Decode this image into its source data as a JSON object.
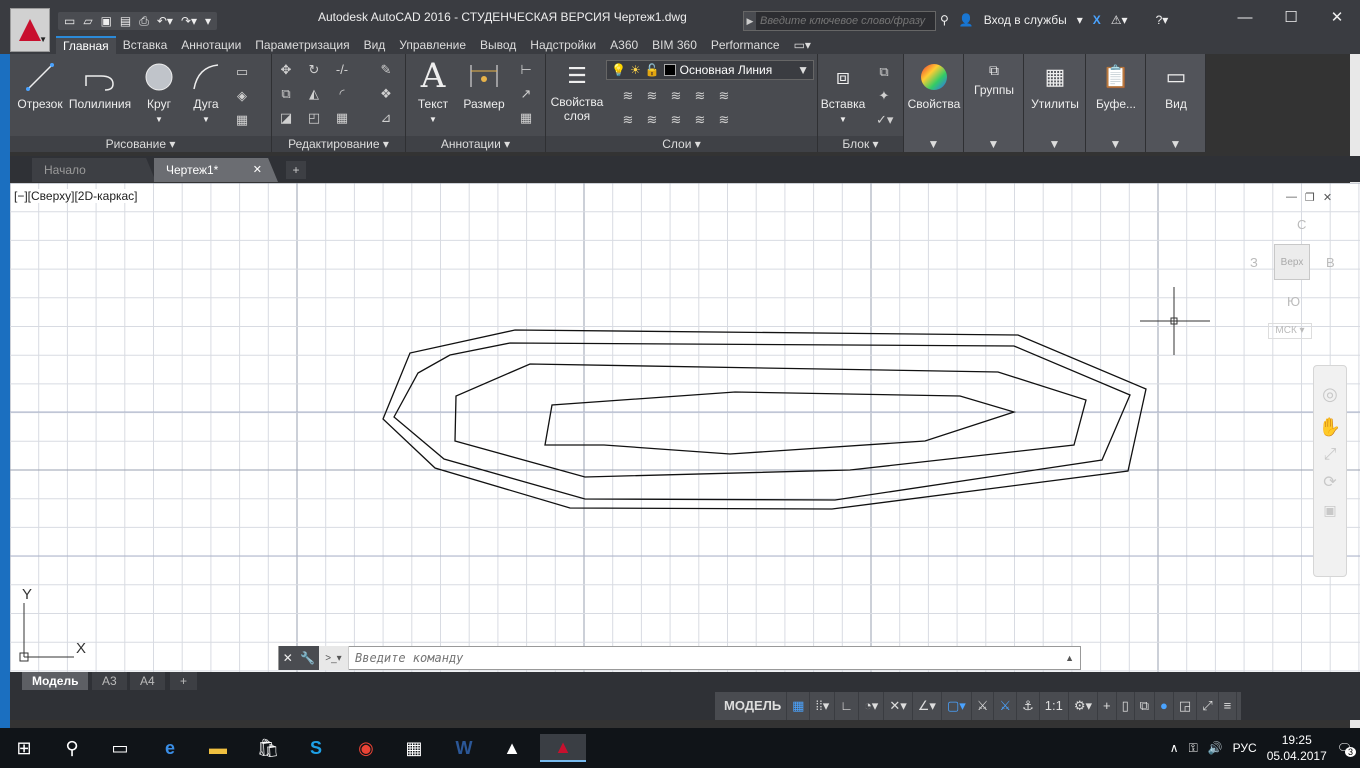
{
  "title": "Autodesk AutoCAD 2016 - СТУДЕНЧЕСКАЯ ВЕРСИЯ     Чертеж1.dwg",
  "search_placeholder": "Введите ключевое слово/фразу",
  "login_label": "Вход в службы",
  "ribbon_tabs": [
    "Главная",
    "Вставка",
    "Аннотации",
    "Параметризация",
    "Вид",
    "Управление",
    "Вывод",
    "Надстройки",
    "A360",
    "BIM 360",
    "Performance"
  ],
  "panels": {
    "draw": {
      "title": "Рисование",
      "tools": [
        "Отрезок",
        "Полилиния",
        "Круг",
        "Дуга"
      ]
    },
    "modify": {
      "title": "Редактирование"
    },
    "annotation": {
      "title": "Аннотации",
      "tools": [
        "Текст",
        "Размер"
      ]
    },
    "layers": {
      "title": "Слои",
      "props_label_line1": "Свойства",
      "props_label_line2": "слоя",
      "layer_name": "Основная Линия"
    },
    "block": {
      "title": "Блок",
      "tool": "Вставка"
    },
    "properties": {
      "label": "Свойства"
    },
    "groups": {
      "label": "Группы"
    },
    "utilities": {
      "label": "Утилиты"
    },
    "clipboard": {
      "label": "Буфе..."
    },
    "view": {
      "label": "Вид"
    }
  },
  "file_tabs": [
    "Начало",
    "Чертеж1*"
  ],
  "viewport_label": "[−][Сверху][2D-каркас]",
  "viewcube": {
    "top": "Верх",
    "n": "С",
    "s": "Ю",
    "w": "З",
    "e": "В",
    "ucs": "МСК"
  },
  "ucs_axes": {
    "x": "X",
    "y": "Y"
  },
  "cmd_placeholder": "Введите команду",
  "layout_tabs": [
    "Модель",
    "A3",
    "A4"
  ],
  "status": {
    "model": "МОДЕЛЬ",
    "scale": "1:1"
  },
  "tray": {
    "lang": "РУС",
    "time": "19:25",
    "date": "05.04.2017",
    "notif": "3"
  },
  "colors": {
    "accent": "#2b8ad8",
    "logo_red": "#c8102e",
    "ribbon_bg": "#494b50"
  }
}
